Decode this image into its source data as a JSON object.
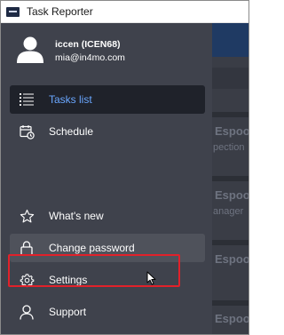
{
  "window": {
    "title": "Task Reporter",
    "logo_icon": "app-logo-icon"
  },
  "user": {
    "name": "iccen (ICEN68)",
    "email": "mia@in4mo.com",
    "avatar_icon": "user-avatar-icon"
  },
  "nav": {
    "tasks_list": {
      "label": "Tasks list",
      "icon": "list-icon"
    },
    "schedule": {
      "label": "Schedule",
      "icon": "calendar-icon"
    },
    "whats_new": {
      "label": "What's new",
      "icon": "star-icon"
    },
    "change_password": {
      "label": "Change password",
      "icon": "lock-icon"
    },
    "settings": {
      "label": "Settings",
      "icon": "gear-icon"
    },
    "support": {
      "label": "Support",
      "icon": "person-icon"
    }
  },
  "background": {
    "cards": [
      {
        "title": "Espoo",
        "subtitle": "pection"
      },
      {
        "title": "Espoo",
        "subtitle": "anager"
      },
      {
        "title": "Espoo",
        "subtitle": ""
      },
      {
        "title": "Espoo",
        "subtitle": ""
      }
    ]
  },
  "colors": {
    "drawer_bg": "#3f424c",
    "active_text": "#6aa7ff",
    "highlight": "#e1212a",
    "header_blue": "#1f3a63"
  }
}
